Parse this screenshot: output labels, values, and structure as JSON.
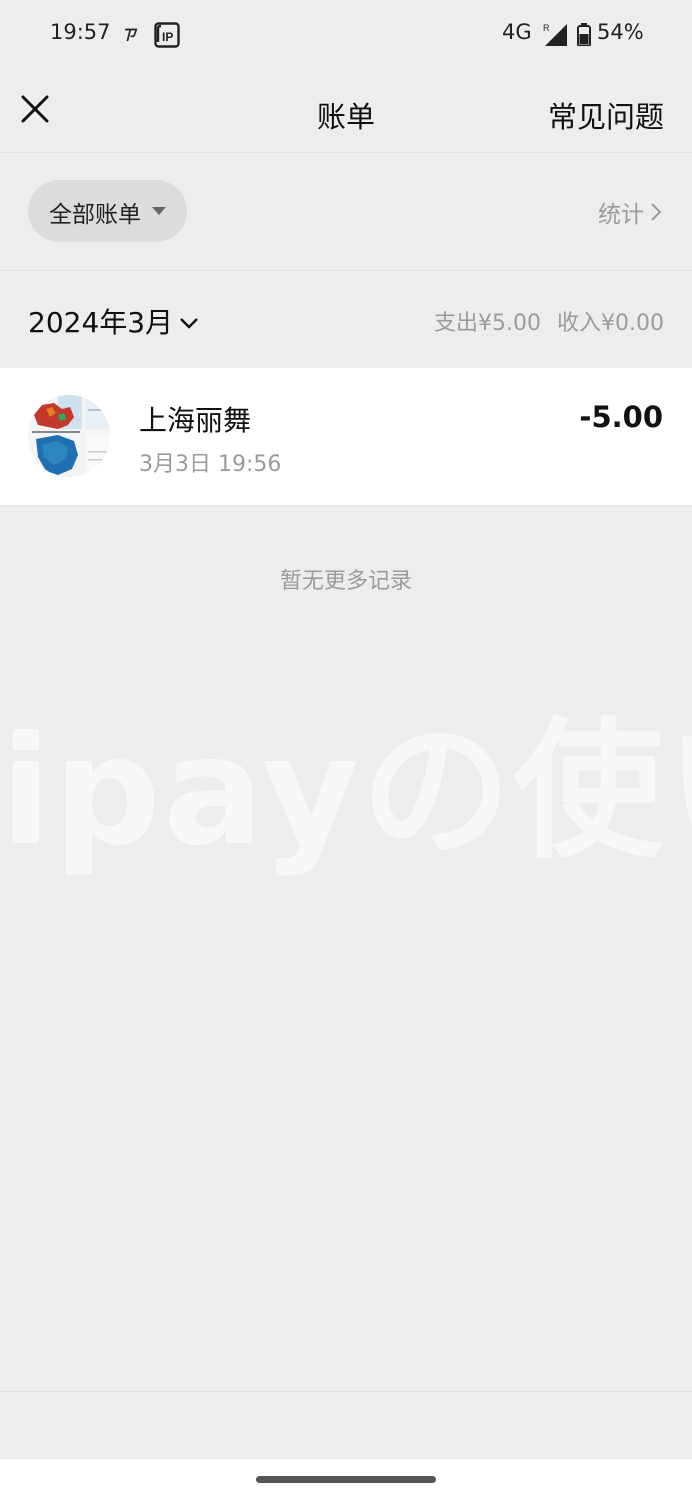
{
  "status_bar": {
    "time": "19:57",
    "network": "4G",
    "battery": "54%",
    "icons": [
      "notification-app-icon",
      "ip-badge-icon",
      "signal-icon",
      "battery-icon"
    ]
  },
  "nav": {
    "title": "账单",
    "faq_label": "常见问题",
    "close_icon": "close-icon"
  },
  "filter": {
    "selected": "全部账单",
    "stats_label": "统计"
  },
  "month": {
    "label": "2024年3月",
    "expense": "支出¥5.00",
    "income": "收入¥0.00"
  },
  "records": [
    {
      "merchant": "上海丽舞",
      "time": "3月3日 19:56",
      "amount": "-5.00"
    }
  ],
  "empty_state": "暂无更多记录",
  "watermark": "ipayの使い",
  "colors": {
    "background": "#ededed",
    "card": "#ffffff",
    "secondary_text": "#9b9b9b",
    "pill": "#dcdcdc"
  }
}
